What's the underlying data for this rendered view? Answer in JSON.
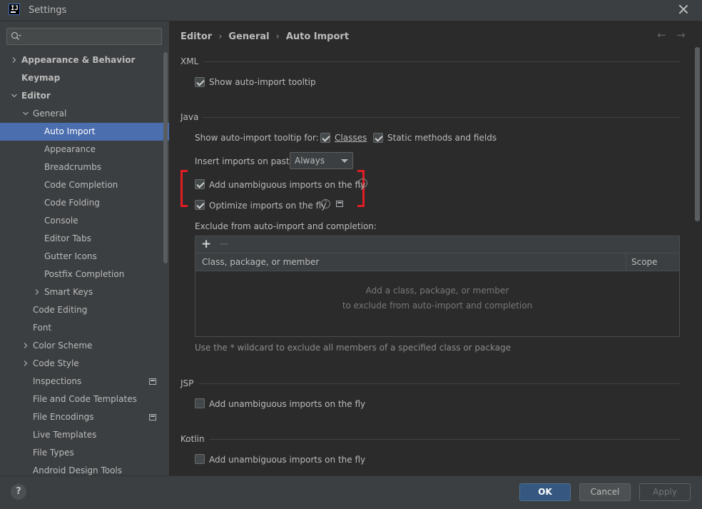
{
  "window": {
    "title": "Settings",
    "app_icon_text": "IJ"
  },
  "breadcrumb": {
    "items": [
      "Editor",
      "General",
      "Auto Import"
    ],
    "separator": "›"
  },
  "nav": {
    "back": "←",
    "forward": "→"
  },
  "sidebar": {
    "search_placeholder": "",
    "items": [
      {
        "label": "Appearance & Behavior",
        "bold": true,
        "expandable": true,
        "expanded": false
      },
      {
        "label": "Keymap",
        "bold": true
      },
      {
        "label": "Editor",
        "bold": true,
        "expandable": true,
        "expanded": true
      },
      {
        "label": "General",
        "expandable": true,
        "expanded": true
      },
      {
        "label": "Auto Import",
        "selected": true
      },
      {
        "label": "Appearance"
      },
      {
        "label": "Breadcrumbs"
      },
      {
        "label": "Code Completion"
      },
      {
        "label": "Code Folding"
      },
      {
        "label": "Console"
      },
      {
        "label": "Editor Tabs"
      },
      {
        "label": "Gutter Icons"
      },
      {
        "label": "Postfix Completion"
      },
      {
        "label": "Smart Keys",
        "expandable": true,
        "expanded": false
      },
      {
        "label": "Code Editing"
      },
      {
        "label": "Font"
      },
      {
        "label": "Color Scheme",
        "expandable": true,
        "expanded": false
      },
      {
        "label": "Code Style",
        "expandable": true,
        "expanded": false
      },
      {
        "label": "Inspections",
        "badge": true
      },
      {
        "label": "File and Code Templates"
      },
      {
        "label": "File Encodings",
        "badge": true
      },
      {
        "label": "Live Templates"
      },
      {
        "label": "File Types"
      },
      {
        "label": "Android Design Tools"
      }
    ]
  },
  "xml": {
    "section": "XML",
    "show_tooltip": {
      "label": "Show auto-import tooltip",
      "checked": true
    }
  },
  "java": {
    "section": "Java",
    "tooltip_for_label": "Show auto-import tooltip for:",
    "classes": {
      "label": "Classes",
      "checked": true
    },
    "static_methods": {
      "label": "Static methods and fields",
      "checked": true
    },
    "insert_on_paste_label": "Insert imports on paste:",
    "insert_on_paste_value": "Always",
    "add_unambiguous": {
      "label": "Add unambiguous imports on the fly",
      "checked": true
    },
    "optimize": {
      "label": "Optimize imports on the fly",
      "checked": true,
      "help": "?"
    },
    "exclude_label": "Exclude from auto-import and completion:",
    "table": {
      "add": "+",
      "remove": "−",
      "columns": [
        "Class, package, or member",
        "Scope"
      ],
      "empty_line1": "Add a class, package, or member",
      "empty_line2": "to exclude from auto-import and completion"
    },
    "hint": "Use the * wildcard to exclude all members of a specified class or package"
  },
  "jsp": {
    "section": "JSP",
    "add_unambiguous": {
      "label": "Add unambiguous imports on the fly",
      "checked": false
    }
  },
  "kotlin": {
    "section": "Kotlin",
    "add_unambiguous": {
      "label": "Add unambiguous imports on the fly",
      "checked": false
    }
  },
  "footer": {
    "help": "?",
    "ok": "OK",
    "cancel": "Cancel",
    "apply": "Apply"
  },
  "colors": {
    "selection": "#4b6eaf",
    "highlight_bracket": "#e31b23",
    "ok_button": "#365880"
  }
}
